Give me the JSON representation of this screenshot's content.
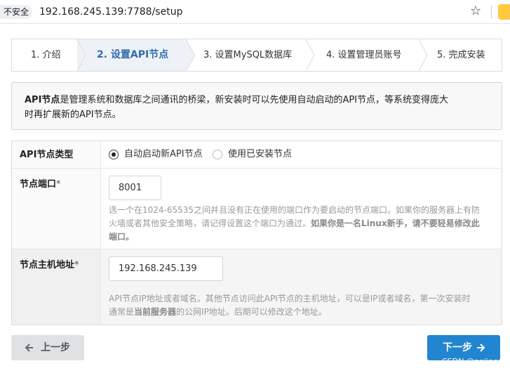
{
  "browser": {
    "security_label": "不安全",
    "url": "192.168.245.139:7788/setup"
  },
  "steps": [
    {
      "label": "1. 介绍"
    },
    {
      "label": "2. 设置API节点"
    },
    {
      "label": "3. 设置MySQL数据库"
    },
    {
      "label": "4. 设置管理员账号"
    },
    {
      "label": "5. 完成安装"
    }
  ],
  "intro": {
    "bold": "API节点",
    "text1": "是管理系统和数据库之间通讯的桥梁，新安装时可以先使用自动启动的API节点，等系统变得庞大",
    "text2": "时再扩展新的API节点。"
  },
  "form": {
    "type_label": "API节点类型",
    "type_options": [
      "自动启动新API节点",
      "使用已安装节点"
    ],
    "selected_type": "自动启动新API节点",
    "port_label": "节点端口",
    "required_mark": "*",
    "port_value": "8001",
    "port_help_line1": "选一个在1024-65535之间并且没有正在使用的端口作为要启动的节点端口。如果你的服务器上有防",
    "port_help_line2a": "火墙或者其他安全策略，请记得设置这个端口为通过。",
    "port_help_line2b": "如果你是一名Linux新手，请不要轻易修改此",
    "port_help_line3": "端口。",
    "host_label": "节点主机地址",
    "host_value": "192.168.245.139",
    "host_help_line1": "API节点IP地址或者域名。其他节点访问此API节点的主机地址，可以是IP或者域名，第一次安装时",
    "host_help_line2a": "通常是",
    "host_help_line2b": "当前服务器",
    "host_help_line2c": "的公网IP地址。后期可以修改这个地址。"
  },
  "buttons": {
    "prev": "上一步",
    "next": "下一步"
  },
  "watermark": "CSDN @peiingo"
}
